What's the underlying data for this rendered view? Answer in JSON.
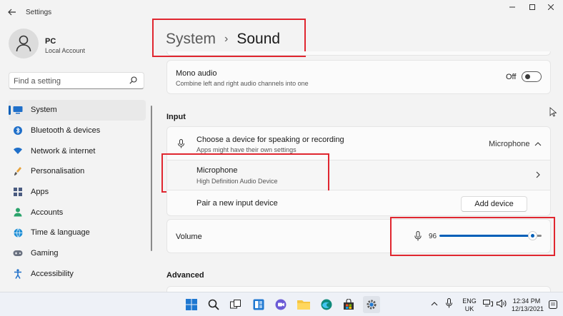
{
  "window": {
    "app_title": "Settings"
  },
  "profile": {
    "name": "PC",
    "account_type": "Local Account"
  },
  "search": {
    "placeholder": "Find a setting"
  },
  "nav": {
    "items": [
      {
        "label": "System",
        "icon": "monitor-icon",
        "active": true
      },
      {
        "label": "Bluetooth & devices",
        "icon": "bluetooth-icon"
      },
      {
        "label": "Network & internet",
        "icon": "wifi-icon"
      },
      {
        "label": "Personalisation",
        "icon": "brush-icon"
      },
      {
        "label": "Apps",
        "icon": "apps-icon"
      },
      {
        "label": "Accounts",
        "icon": "person-icon"
      },
      {
        "label": "Time & language",
        "icon": "globe-icon"
      },
      {
        "label": "Gaming",
        "icon": "gamepad-icon"
      },
      {
        "label": "Accessibility",
        "icon": "accessibility-icon"
      }
    ]
  },
  "breadcrumb": {
    "parent": "System",
    "separator": "›",
    "current": "Sound"
  },
  "mono_audio": {
    "title": "Mono audio",
    "subtitle": "Combine left and right audio channels into one",
    "state_label": "Off",
    "enabled": false
  },
  "input_section": {
    "label": "Input",
    "choose_device": {
      "title": "Choose a device for speaking or recording",
      "subtitle": "Apps might have their own settings",
      "selected": "Microphone"
    },
    "microphone": {
      "title": "Microphone",
      "subtitle": "High Definition Audio Device"
    },
    "pair_device": {
      "title": "Pair a new input device",
      "button_label": "Add device"
    },
    "volume": {
      "label": "Volume",
      "value": "96",
      "level_fraction": 0.96
    }
  },
  "advanced_section": {
    "label": "Advanced"
  },
  "taskbar": {
    "apps": [
      "start-icon",
      "search-icon",
      "task-view-icon",
      "widgets-icon",
      "chat-icon",
      "file-explorer-icon",
      "edge-icon",
      "store-icon",
      "settings-icon"
    ],
    "language_line1": "ENG",
    "language_line2": "UK",
    "time": "12:34 PM",
    "date": "12/13/2021"
  },
  "colors": {
    "accent": "#005fb8",
    "highlight_box": "#e0262f"
  }
}
